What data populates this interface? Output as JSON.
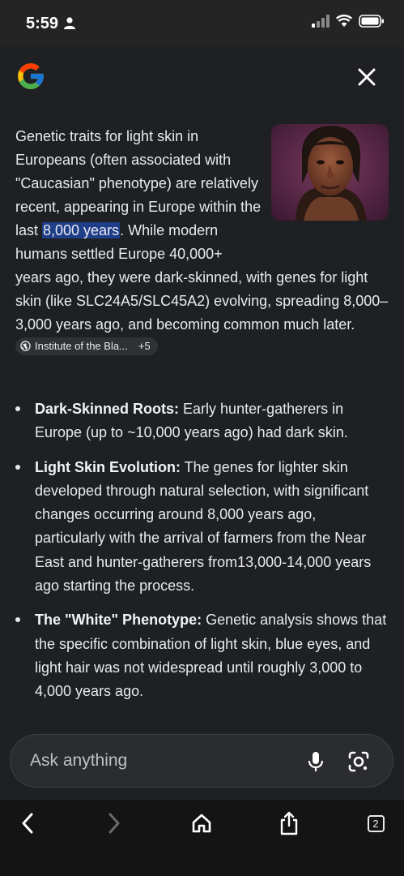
{
  "status": {
    "time": "5:59",
    "icons": [
      "person-icon",
      "cellular-signal-icon",
      "wifi-icon",
      "battery-icon"
    ]
  },
  "header": {
    "logo": "google-g-logo",
    "close": "close-icon"
  },
  "answer": {
    "intro_part1": "Genetic traits for light skin in Europeans (often associated with \"Caucasian\" phenotype) are relatively recent, appearing in Europe within the last ",
    "intro_highlight": "8,000 years",
    "intro_part2": ". While modern humans settled Europe 40,000+ years ago, they were dark-skinned, with genes for light skin (like SLC24A5/SLC45A2) evolving, spreading 8,000–3,000 years ago, and becoming common much later.",
    "source_chip": {
      "label": "Institute of the Bla...",
      "more": "+5"
    },
    "bullets": [
      {
        "title": "Dark-Skinned Roots:",
        "text": " Early hunter-gatherers in Europe (up to ~10,000 years ago) had dark skin."
      },
      {
        "title": "Light Skin Evolution:",
        "text": " The genes for lighter skin developed through natural selection, with significant changes occurring around 8,000 years ago, particularly with the arrival of farmers from the Near East and hunter-gatherers from13,000-14,000 years ago starting the process."
      },
      {
        "title": "The \"White\" Phenotype:",
        "text": " Genetic analysis shows that the specific combination of light skin, blue eyes, and light hair was not widespread until roughly 3,000 to 4,000 years ago."
      }
    ]
  },
  "ask": {
    "placeholder": "Ask anything"
  },
  "nav": {
    "tab_count": "2"
  },
  "colors": {
    "background": "#1f2023",
    "highlight": "#1f3e8a",
    "nav_background": "#141414"
  }
}
